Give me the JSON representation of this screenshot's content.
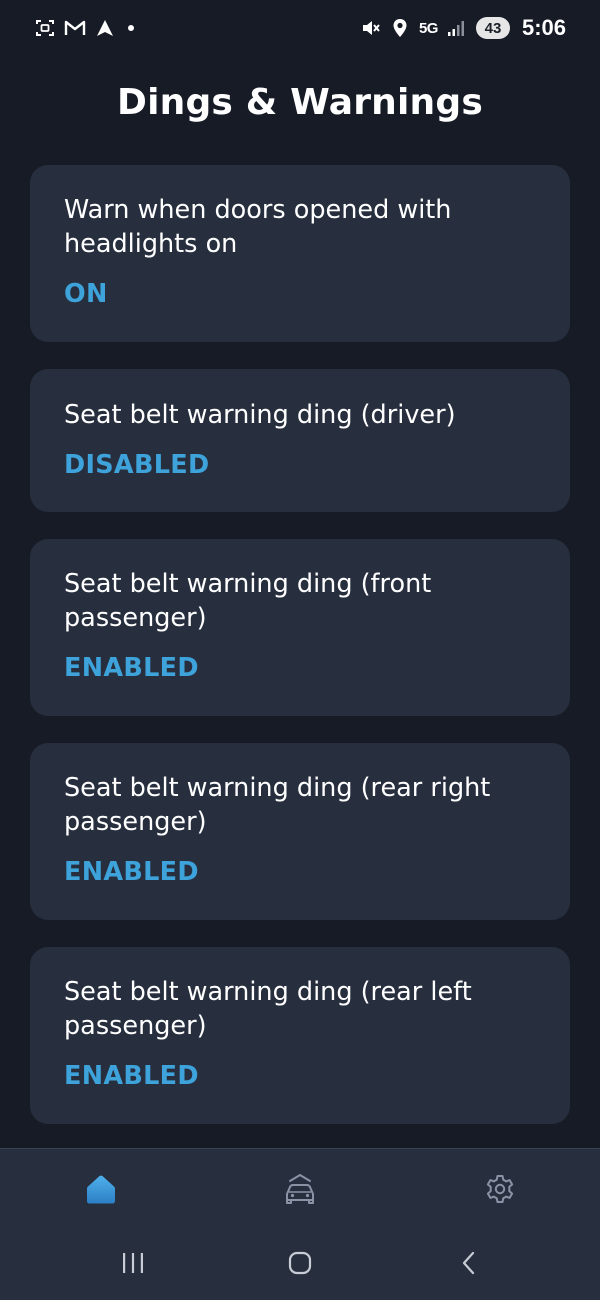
{
  "status_bar": {
    "time": "5:06",
    "network": "5G",
    "battery": "43",
    "icons": [
      "screenshot-icon",
      "gmail-icon",
      "navigation-icon",
      "notification-dot",
      "mute-icon",
      "location-icon",
      "signal-icon"
    ]
  },
  "page": {
    "title": "Dings & Warnings"
  },
  "settings": [
    {
      "label": "Warn when doors opened with headlights on",
      "value": "ON"
    },
    {
      "label": "Seat belt warning ding (driver)",
      "value": "DISABLED"
    },
    {
      "label": "Seat belt warning ding (front passenger)",
      "value": "ENABLED"
    },
    {
      "label": "Seat belt warning ding (rear right passenger)",
      "value": "ENABLED"
    },
    {
      "label": "Seat belt warning ding (rear left passenger)",
      "value": "ENABLED"
    }
  ],
  "bottom_nav": {
    "items": [
      {
        "icon": "home-icon",
        "active": true
      },
      {
        "icon": "car-icon",
        "active": false
      },
      {
        "icon": "gear-icon",
        "active": false
      }
    ]
  },
  "system_nav": {
    "icons": [
      "recents-icon",
      "home-button-icon",
      "back-icon"
    ]
  },
  "colors": {
    "background": "#161b25",
    "card": "#272f3f",
    "accent": "#3da3da",
    "text": "#ffffff",
    "icon_inactive": "#8a93a6"
  }
}
